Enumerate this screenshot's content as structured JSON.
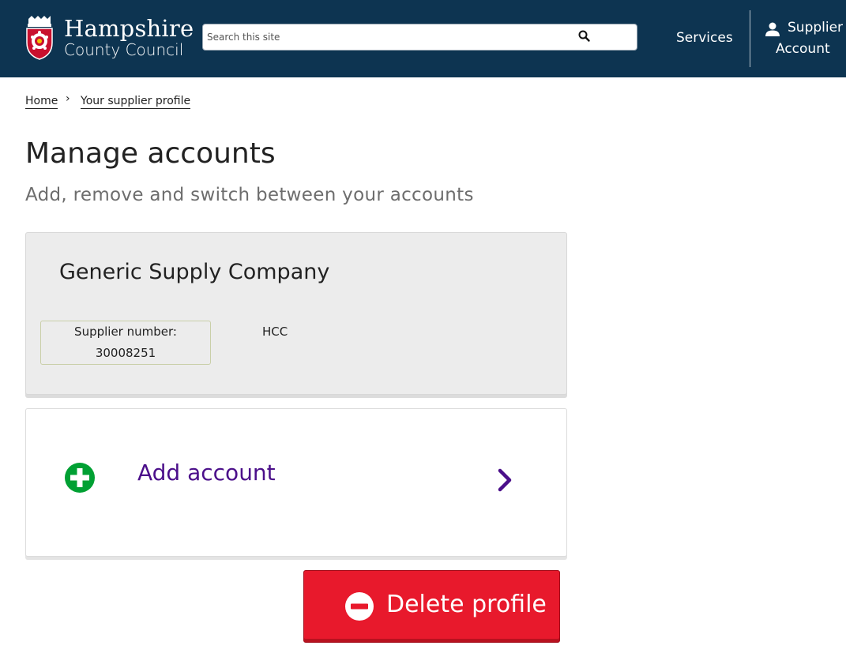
{
  "header": {
    "logo": {
      "line1": "Hampshire",
      "line2": "County Council"
    },
    "search": {
      "placeholder": "Search this site",
      "value": ""
    },
    "nav": {
      "services": "Services",
      "account_line1": "Supplier",
      "account_line2": "Account"
    },
    "colors": {
      "background": "#0d3451",
      "text": "#ffffff"
    }
  },
  "breadcrumb": {
    "items": [
      {
        "label": "Home"
      },
      {
        "label": "Your supplier profile"
      }
    ],
    "separator": "›"
  },
  "page": {
    "title": "Manage accounts",
    "subtitle": "Add, remove and switch between your accounts"
  },
  "account_card": {
    "company_name": "Generic Supply Company",
    "supplier_number_label": "Supplier number:",
    "supplier_number": "30008251",
    "organisation": "HCC"
  },
  "add_account": {
    "label": "Add account",
    "icon": "plus-circle-icon",
    "chevron": "chevron-right-icon",
    "colors": {
      "link": "#4b0f8a",
      "icon": "#00a033"
    }
  },
  "delete_profile": {
    "label": "Delete profile",
    "icon": "minus-circle-icon",
    "colors": {
      "background": "#e8192c",
      "text": "#ffffff"
    }
  }
}
